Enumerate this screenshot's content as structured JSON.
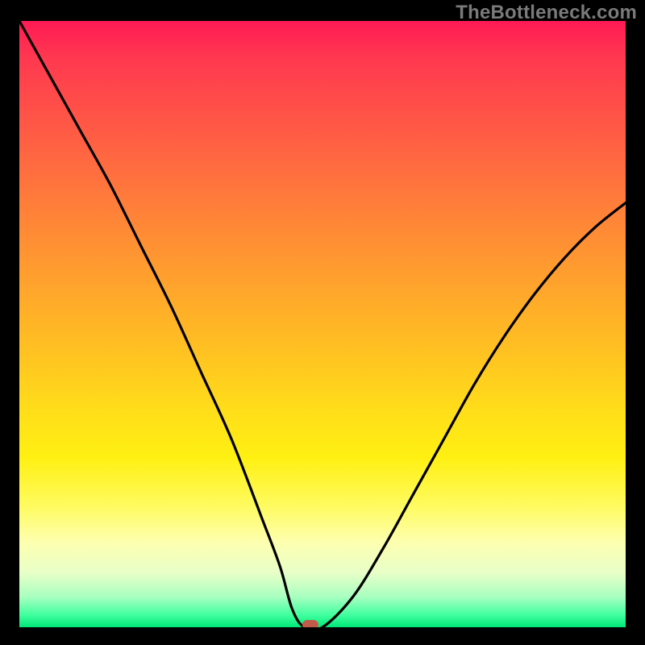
{
  "watermark": "TheBottleneck.com",
  "chart_data": {
    "type": "line",
    "title": "",
    "xlabel": "",
    "ylabel": "",
    "xlim": [
      0,
      100
    ],
    "ylim": [
      0,
      100
    ],
    "series": [
      {
        "name": "bottleneck-curve",
        "x": [
          0,
          5,
          10,
          15,
          20,
          25,
          30,
          35,
          40,
          43,
          45,
          47,
          50,
          55,
          60,
          65,
          70,
          75,
          80,
          85,
          90,
          95,
          100
        ],
        "values": [
          100,
          91,
          82,
          73,
          63,
          53,
          42,
          31,
          18,
          10,
          3,
          0,
          0,
          5,
          13,
          22,
          31,
          40,
          48,
          55,
          61,
          66,
          70
        ]
      }
    ],
    "optimum_marker": {
      "x": 48,
      "y": 0
    },
    "background_gradient": {
      "0": "#ff1a55",
      "50": "#ffc022",
      "80": "#fffb60",
      "100": "#00e878"
    }
  }
}
